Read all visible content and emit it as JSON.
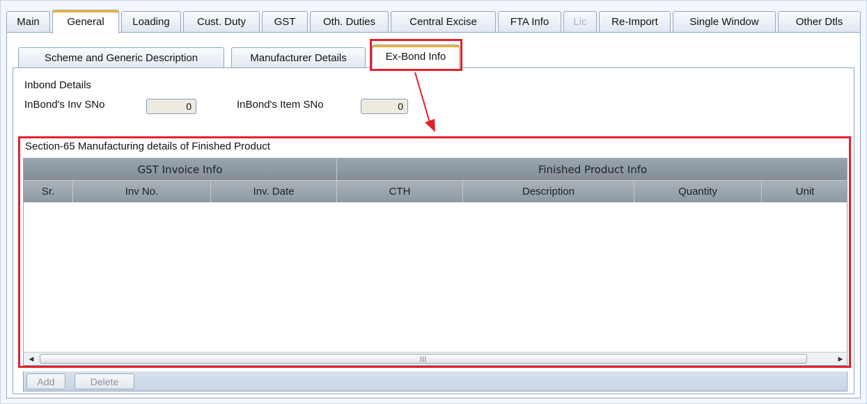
{
  "top_tabs": {
    "main": "Main",
    "general": "General",
    "loading": "Loading",
    "cust_duty": "Cust. Duty",
    "gst": "GST",
    "oth_duties": "Oth. Duties",
    "central_excise": "Central Excise",
    "fta_info": "FTA Info",
    "lic": "Lic",
    "re_import": "Re-Import",
    "single_window": "Single Window",
    "other_dtls": "Other Dtls"
  },
  "sub_tabs": {
    "scheme": "Scheme and Generic Description",
    "manufacturer": "Manufacturer Details",
    "exbond": "Ex-Bond Info"
  },
  "inbond": {
    "heading": "Inbond Details",
    "inv_sno_label": "InBond's Inv SNo",
    "inv_sno_value": "0",
    "item_sno_label": "InBond's Item SNo",
    "item_sno_value": "0"
  },
  "grid": {
    "section_title": "Section-65 Manufacturing details of Finished Product",
    "group_gst": "GST Invoice Info",
    "group_finished": "Finished Product Info",
    "col_sr": "Sr.",
    "col_inv_no": "Inv No.",
    "col_inv_date": "Inv. Date",
    "col_cth": "CTH",
    "col_description": "Description",
    "col_quantity": "Quantity",
    "col_unit": "Unit",
    "rows": []
  },
  "buttons": {
    "add": "Add",
    "delete": "Delete"
  },
  "colors": {
    "highlight": "#e3202a",
    "active_tab_accent": "#f0b233",
    "header_gray": "#8e99a2"
  }
}
